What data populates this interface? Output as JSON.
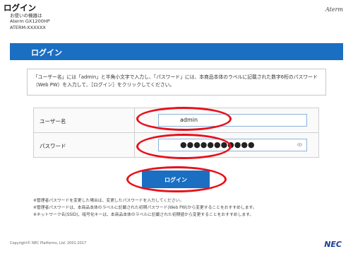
{
  "header": {
    "title": "ログイン",
    "model_label": "お使いの機器は",
    "model": "Aterm GX1200HP",
    "ssid": "ATERM-XXXXXX",
    "brand": "Aterm"
  },
  "title_bar": {
    "text": "ログイン"
  },
  "instructions": "「ユーザー名」には「admin」と半角小文字で入力し、「パスワード」には、本商品本体のラベルに記載された数字6桁のパスワード（Web PW）を入力して、［ログイン］をクリックしてください。",
  "form": {
    "username_label": "ユーザー名",
    "username_value": "admin",
    "password_label": "パスワード",
    "password_mask": "●●●●●●●●●●●"
  },
  "login_button": "ログイン",
  "notes": [
    "※管理者パスワードを変更した場合は、変更したパスワードを入力してください。",
    "※管理者パスワードは、本商品本体のラベルに記載された初期パスワード(Web PW)から変更することをおすすめします。",
    "※ネットワーク名(SSID)、暗号化キーは、本商品本体のラベルに記載された初期値から変更することをおすすめします。"
  ],
  "footer": {
    "copyright": "Copyright© NEC Platforms, Ltd. 2001-2017",
    "logo": "NEC"
  },
  "colors": {
    "accent": "#1a6fc3",
    "highlight_ring": "#e8101a"
  }
}
